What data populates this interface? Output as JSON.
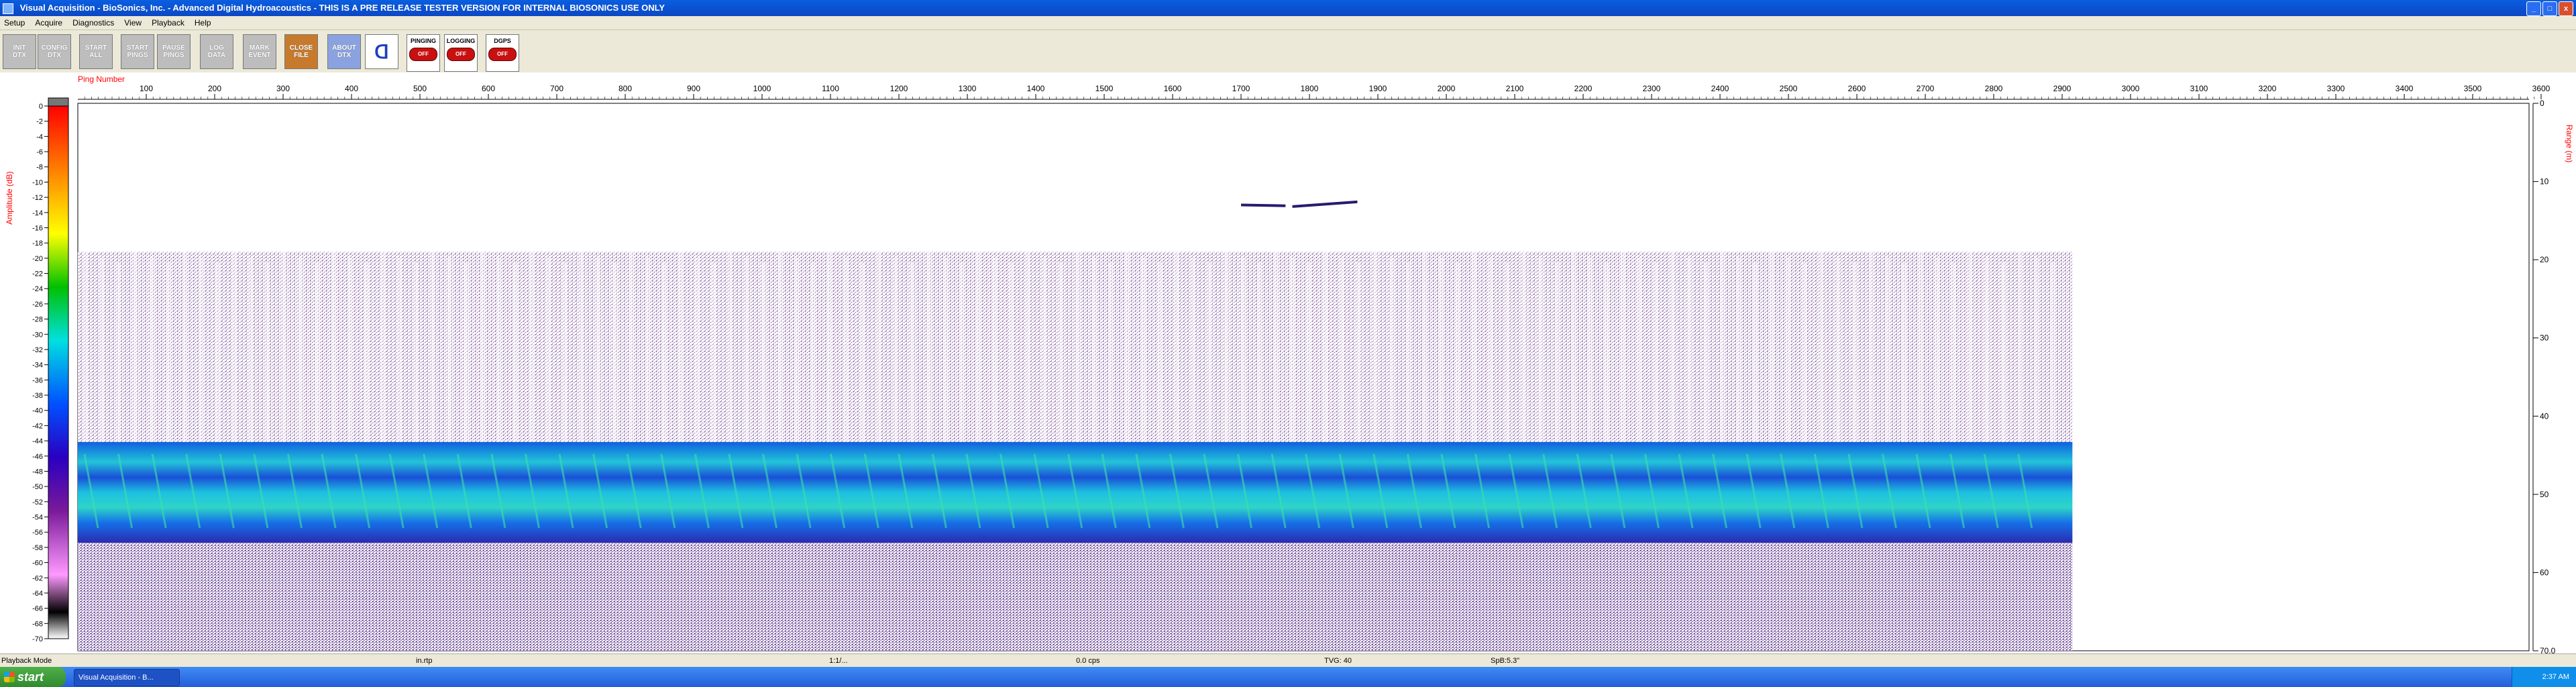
{
  "window": {
    "title": "Visual Acquisition - BioSonics, Inc. - Advanced Digital Hydroacoustics - THIS IS A PRE RELEASE TESTER VERSION FOR INTERNAL BIOSONICS USE ONLY",
    "minimize": "_",
    "maximize": "□",
    "close": "x"
  },
  "menu": [
    "Setup",
    "Acquire",
    "Diagnostics",
    "View",
    "Playback",
    "Help"
  ],
  "toolbar": [
    {
      "line1": "INIT",
      "line2": "DTX"
    },
    {
      "line1": "CONFIG",
      "line2": "DTX"
    },
    {
      "line1": "START",
      "line2": "ALL"
    },
    {
      "line1": "START",
      "line2": "PINGS"
    },
    {
      "line1": "PAUSE",
      "line2": "PINGS"
    },
    {
      "line1": "LOG",
      "line2": "DATA"
    },
    {
      "line1": "MARK",
      "line2": "EVENT"
    },
    {
      "line1": "CLOSE",
      "line2": "FILE"
    },
    {
      "line1": "ABOUT",
      "line2": "DTX"
    }
  ],
  "status_buttons": [
    {
      "label": "PINGING",
      "state": "OFF"
    },
    {
      "label": "LOGGING",
      "state": "OFF"
    },
    {
      "label": "DGPS",
      "state": "OFF"
    }
  ],
  "plot": {
    "ping_axis_label": "Ping Number",
    "amplitude_label": "Amplitude (dB)",
    "range_label": "Range (m)",
    "ping_ticks": [
      100,
      200,
      300,
      400,
      500,
      600,
      700,
      800,
      900,
      1000,
      1100,
      1200,
      1300,
      1400,
      1500,
      1600,
      1700,
      1800,
      1900,
      2000,
      2100,
      2200,
      2300,
      2400,
      2500,
      2600,
      2700,
      2800,
      2900,
      3000,
      3100,
      3200,
      3300,
      3400,
      3500,
      3600
    ],
    "amplitude_ticks": [
      0,
      -2,
      -4,
      -6,
      -8,
      -10,
      -12,
      -14,
      -16,
      -18,
      -20,
      -22,
      -24,
      -26,
      -28,
      -30,
      -32,
      -34,
      -36,
      -38,
      -40,
      -42,
      -44,
      -46,
      -48,
      -50,
      -52,
      -54,
      -56,
      -58,
      -60,
      -62,
      -64,
      -66,
      -68,
      -70
    ],
    "range_ticks": [
      "0",
      "10",
      "20",
      "30",
      "40",
      "50",
      "60",
      "70.0"
    ],
    "colors": {
      "bottom_band": "#1e6fe0",
      "bottom_hot": "#22c4d8",
      "scatter": "#5a1a7a",
      "axis_label": "#ff0000"
    }
  },
  "statusbar": {
    "mode": "Playback Mode",
    "file": "in.rtp",
    "position": "1:1/...",
    "rate": "0.0 cps",
    "tvg": "TVG: 40",
    "spb": "SpB:5.3\""
  },
  "taskbar": {
    "start": "start",
    "task": "Visual Acquisition - B...",
    "clock": "2:37 AM"
  }
}
